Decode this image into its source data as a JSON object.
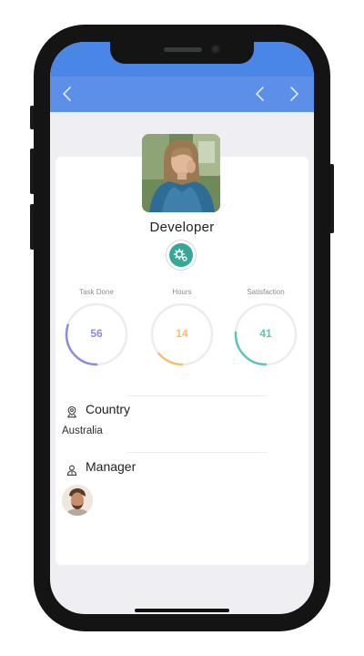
{
  "profile": {
    "role": "Developer"
  },
  "stats": [
    {
      "label": "Task Done",
      "value": "56",
      "fraction": 0.3,
      "color": "#8a8ce0"
    },
    {
      "label": "Hours",
      "value": "14",
      "fraction": 0.14,
      "color": "#f1c170"
    },
    {
      "label": "Satisfaction",
      "value": "41",
      "fraction": 0.26,
      "color": "#5cc4b8"
    }
  ],
  "country": {
    "title": "Country",
    "value": "Australia"
  },
  "manager": {
    "title": "Manager"
  },
  "colors": {
    "nav": "#5b8fe8",
    "status": "#4a86e6",
    "accent": "#35a898",
    "screen_bg": "#efeff3"
  },
  "icons": {
    "back": "chevron-left-icon",
    "prev": "chevron-left-icon",
    "next": "chevron-right-icon",
    "settings": "gear-icon",
    "country": "location-pin-icon",
    "manager": "user-icon"
  }
}
